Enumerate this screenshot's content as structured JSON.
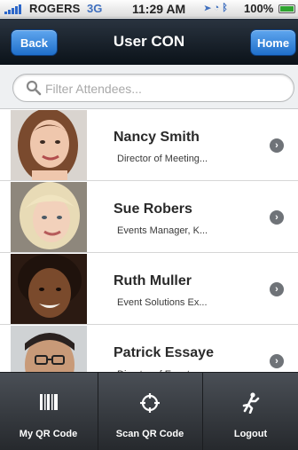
{
  "status": {
    "carrier": "ROGERS",
    "network": "3G",
    "time": "11:29 AM",
    "battery": "100%",
    "icons": [
      "location-icon",
      "alarm-icon",
      "bluetooth-icon"
    ]
  },
  "nav": {
    "back_label": "Back",
    "title": "User CON",
    "home_label": "Home"
  },
  "search": {
    "placeholder": "Filter Attendees..."
  },
  "attendees": [
    {
      "name": "Nancy Smith",
      "role": "Director of Meeting..."
    },
    {
      "name": "Sue Robers",
      "role": "Events Manager, K..."
    },
    {
      "name": "Ruth Muller",
      "role": "Event Solutions Ex..."
    },
    {
      "name": "Patrick Essaye",
      "role": "Director of Events"
    }
  ],
  "tabs": [
    {
      "label": "My QR Code",
      "icon": "barcode-icon"
    },
    {
      "label": "Scan QR Code",
      "icon": "crosshair-icon"
    },
    {
      "label": "Logout",
      "icon": "running-man-icon"
    }
  ],
  "colors": {
    "nav_button": "#1f6fcb",
    "nav_bar": "#0b1219",
    "tab_bar": "#26292d"
  }
}
